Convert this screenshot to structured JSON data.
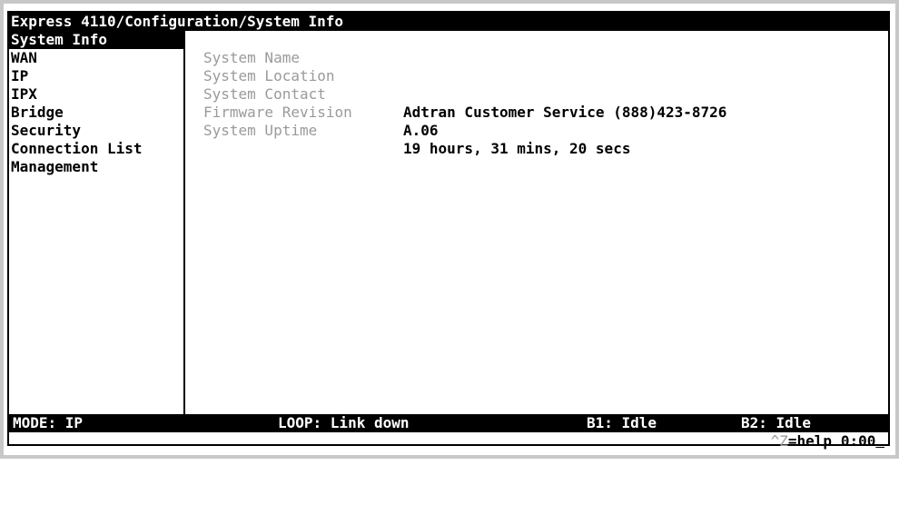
{
  "title": "Express 4110/Configuration/System Info",
  "menu": {
    "items": [
      {
        "label": "System Info",
        "selected": true
      },
      {
        "label": "WAN"
      },
      {
        "label": "IP"
      },
      {
        "label": "IPX"
      },
      {
        "label": "Bridge"
      },
      {
        "label": "Security"
      },
      {
        "label": "Connection List"
      },
      {
        "label": "Management"
      }
    ]
  },
  "fields": [
    {
      "label": "System Name",
      "value": ""
    },
    {
      "label": "System Location",
      "value": ""
    },
    {
      "label": "System Contact",
      "value": "Adtran Customer Service (888)423-8726"
    },
    {
      "label": "Firmware Revision",
      "value": "A.06"
    },
    {
      "label": "System Uptime",
      "value": "19 hours, 31 mins, 20 secs"
    }
  ],
  "status": {
    "mode": "MODE: IP",
    "loop": "LOOP: Link down",
    "b1": "B1: Idle",
    "b2": "B2: Idle"
  },
  "help": {
    "ctrl": "^Z",
    "text": "=help"
  },
  "clock": "0:00"
}
